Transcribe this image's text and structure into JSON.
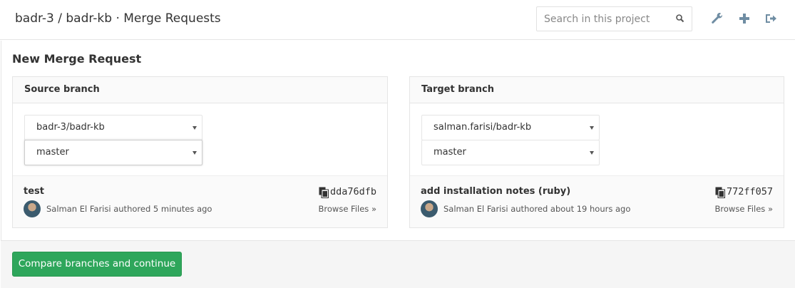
{
  "header": {
    "title": "badr-3 / badr-kb · Merge Requests",
    "search_placeholder": "Search in this project"
  },
  "section_title": "New Merge Request",
  "source": {
    "heading": "Source branch",
    "project": "badr-3/badr-kb",
    "branch": "master",
    "commit": {
      "title": "test",
      "sha": "dda76dfb",
      "author_line": "Salman El Farisi authored 5 minutes ago",
      "browse": "Browse Files »"
    }
  },
  "target": {
    "heading": "Target branch",
    "project": "salman.farisi/badr-kb",
    "branch": "master",
    "commit": {
      "title": "add installation notes (ruby)",
      "sha": "772ff057",
      "author_line": "Salman El Farisi authored about 19 hours ago",
      "browse": "Browse Files »"
    }
  },
  "actions": {
    "compare_label": "Compare branches and continue"
  },
  "colors": {
    "primary_button": "#2ea65b",
    "panel_header": "#fafafa"
  },
  "icons": {
    "search": "search-icon",
    "settings": "wrench-icon",
    "new": "plus-icon",
    "logout": "sign-out-icon",
    "copy": "copy-icon"
  }
}
